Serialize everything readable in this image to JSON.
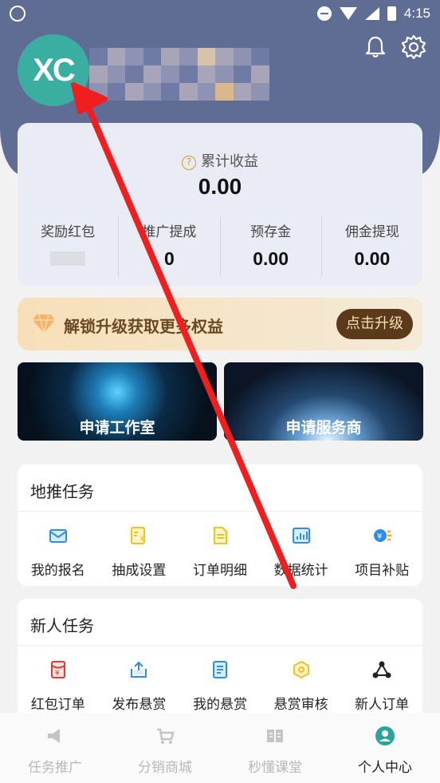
{
  "status_bar": {
    "time": "4:15"
  },
  "profile": {
    "avatar_text": "XC"
  },
  "earnings": {
    "total_label": "累计收益",
    "total_value": "0.00",
    "columns": [
      {
        "label": "奖励红包",
        "value": ""
      },
      {
        "label": "推广提成",
        "value": "0"
      },
      {
        "label": "预存金",
        "value": "0.00"
      },
      {
        "label": "佣金提现",
        "value": "0.00"
      }
    ]
  },
  "upgrade": {
    "text": "解锁升级获取更多权益",
    "button": "点击升级"
  },
  "promos": [
    {
      "label": "申请工作室"
    },
    {
      "label": "申请服务商"
    }
  ],
  "ground_tasks": {
    "title": "地推任务",
    "items": [
      {
        "label": "我的报名",
        "icon": "envelope-icon"
      },
      {
        "label": "抽成设置",
        "icon": "yen-doc-icon"
      },
      {
        "label": "订单明细",
        "icon": "document-icon"
      },
      {
        "label": "数据统计",
        "icon": "bar-chart-icon"
      },
      {
        "label": "项目补贴",
        "icon": "coin-icon"
      }
    ]
  },
  "new_tasks": {
    "title": "新人任务",
    "items": [
      {
        "label": "红包订单",
        "icon": "red-envelope-icon"
      },
      {
        "label": "发布悬赏",
        "icon": "upload-icon"
      },
      {
        "label": "我的悬赏",
        "icon": "document-icon"
      },
      {
        "label": "悬赏审核",
        "icon": "hexagon-icon"
      },
      {
        "label": "新人订单",
        "icon": "network-icon"
      }
    ]
  },
  "bottom_nav": [
    {
      "label": "任务推广",
      "icon": "megaphone-icon"
    },
    {
      "label": "分销商城",
      "icon": "cart-icon"
    },
    {
      "label": "秒懂课堂",
      "icon": "book-icon"
    },
    {
      "label": "个人中心",
      "icon": "person-icon",
      "active": true
    }
  ],
  "colors": {
    "header": "#5f6d95",
    "avatar": "#3aaea0",
    "accent_blue": "#2d8ee6",
    "accent_yellow": "#f0c419",
    "upgrade_button": "#5a3a1b",
    "arrow": "#f01e1e"
  }
}
